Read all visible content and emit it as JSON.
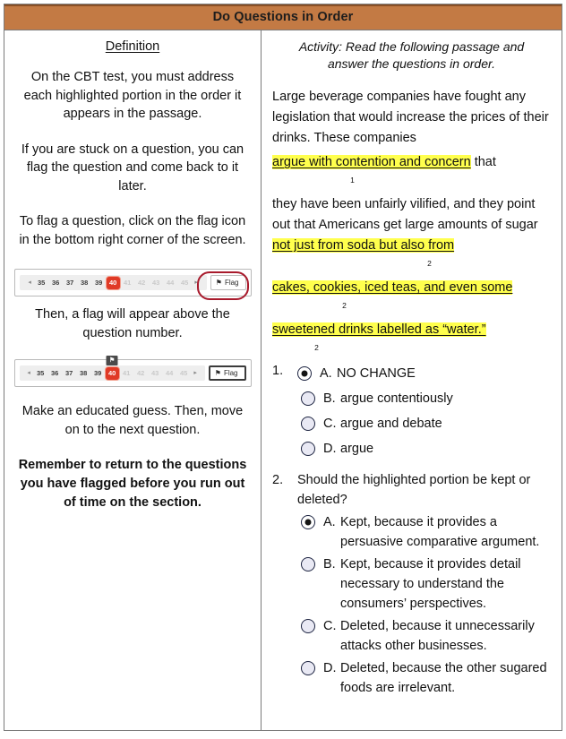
{
  "header": {
    "title": "Do Questions in Order",
    "bar_color": "#c37a44"
  },
  "left_column": {
    "heading": "Definition",
    "paragraphs": [
      "On the CBT test, you must address each highlighted portion in the order it appears in the passage.",
      "If you are stuck on a question, you can flag the question and come back to it later.",
      "To flag a question, click on the flag icon in the bottom right corner of the screen."
    ],
    "after_first_widget": "Then, a flag will appear above the question number.",
    "after_second_widget": "Make an educated guess. Then, move on to the next question.",
    "bold_reminder": "Remember to return to the questions you have flagged before you run out of time on the section."
  },
  "nav_widget_1": {
    "prev_arrow": "◂",
    "next_arrow": "▸",
    "numbers": [
      "35",
      "36",
      "37",
      "38",
      "39",
      "40",
      "41",
      "42",
      "43",
      "44",
      "45"
    ],
    "current": "40",
    "current_color": "#e03a26",
    "flag_label": "Flag",
    "flag_icon": "flag-icon",
    "annotation": "red-oval-highlight"
  },
  "nav_widget_2": {
    "prev_arrow": "◂",
    "next_arrow": "▸",
    "numbers": [
      "35",
      "36",
      "37",
      "38",
      "39",
      "40",
      "41",
      "42",
      "43",
      "44",
      "45"
    ],
    "current": "40",
    "current_color": "#e03a26",
    "flag_label": "Flag",
    "flag_icon": "flag-icon",
    "flag_marker_icon": "flag-marker-icon"
  },
  "right_column": {
    "activity_heading": "Activity: Read the following passage and answer the questions in order.",
    "passage": {
      "p1": "Large beverage companies have fought any legislation that would increase the prices of their drinks. These companies",
      "hl1": "argue with contention and concern",
      "hl1_tail": " that",
      "hl1_sub": "1",
      "p2_lead": "they have been unfairly vilified, and they point out that Americans get large amounts of sugar ",
      "hl2a": "not just from soda but also from",
      "hl2a_sub": "2",
      "hl2b": "cakes, cookies, iced teas, and even some",
      "hl2b_sub": "2",
      "hl2c": "sweetened drinks labelled as “water.”",
      "hl2c_sub": "2",
      "highlight_color": "#ffff4d"
    },
    "questions": [
      {
        "number": "1.",
        "prompt": "",
        "options": [
          {
            "letter": "A.",
            "text": "NO CHANGE",
            "selected": true
          },
          {
            "letter": "B.",
            "text": "argue contentiously",
            "selected": false
          },
          {
            "letter": "C.",
            "text": "argue and debate",
            "selected": false
          },
          {
            "letter": "D.",
            "text": "argue",
            "selected": false
          }
        ]
      },
      {
        "number": "2.",
        "prompt": "Should the highlighted portion be kept or deleted?",
        "options": [
          {
            "letter": "A.",
            "text": "Kept, because it provides a persuasive comparative argument.",
            "selected": true
          },
          {
            "letter": "B.",
            "text": "Kept, because it provides detail necessary to understand the consumers’ perspectives.",
            "selected": false
          },
          {
            "letter": "C.",
            "text": "Deleted, because it unnecessarily attacks other businesses.",
            "selected": false
          },
          {
            "letter": "D.",
            "text": "Deleted, because the other sugared foods are irrelevant.",
            "selected": false
          }
        ]
      }
    ]
  }
}
